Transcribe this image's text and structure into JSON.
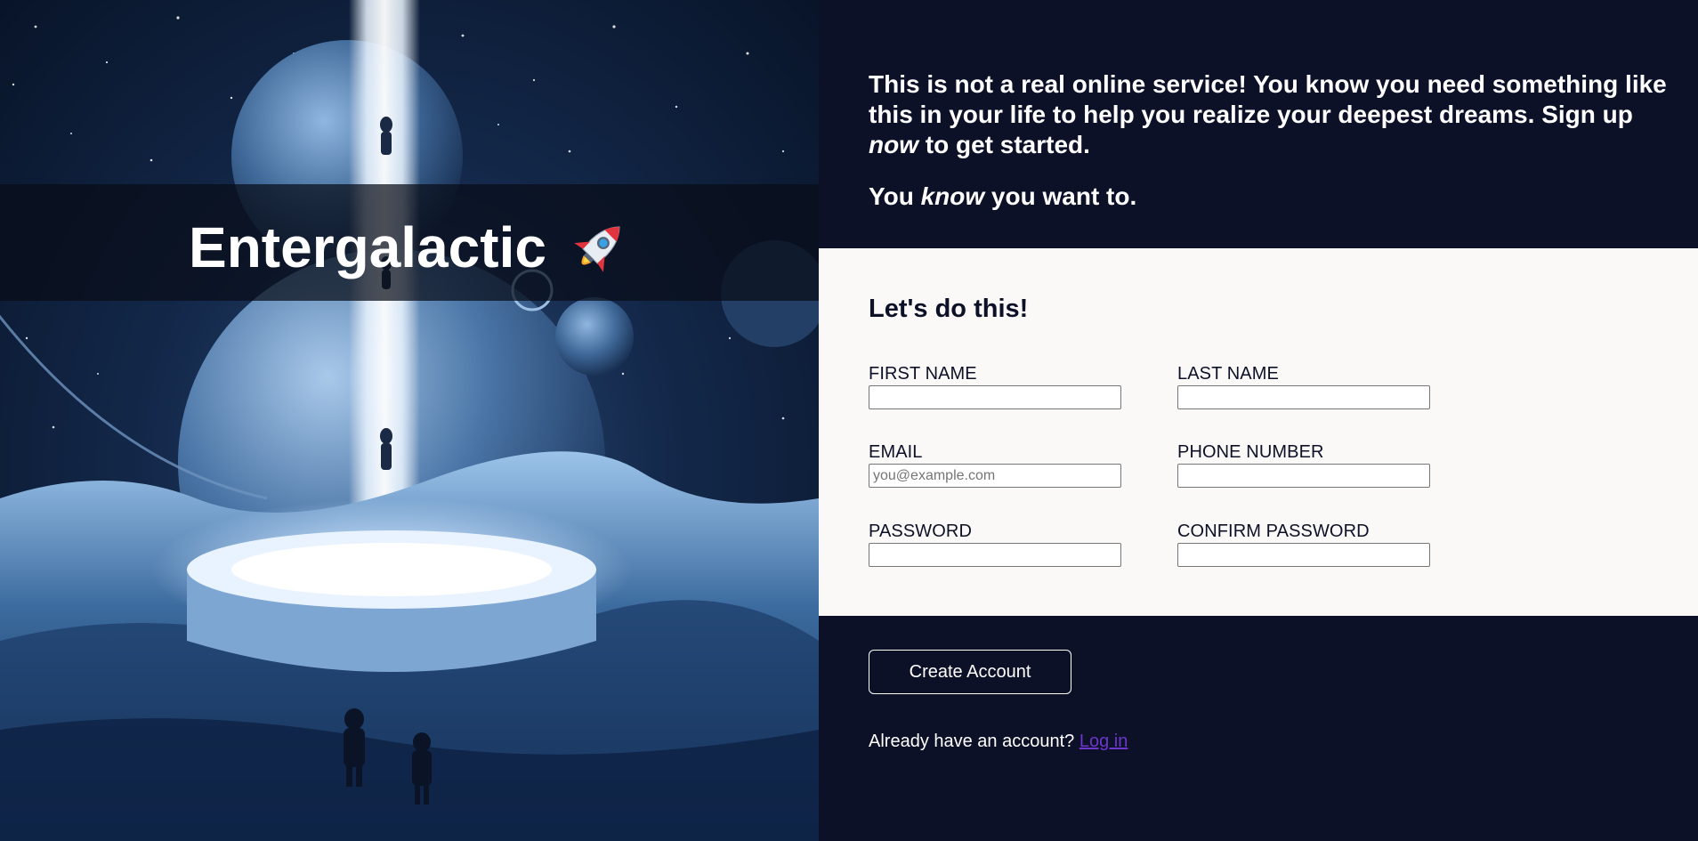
{
  "hero": {
    "brand_title": "Entergalactic",
    "brand_icon": "rocket-icon",
    "image_alt": "astronauts-on-alien-planet-illustration"
  },
  "intro": {
    "line1_a": "This is not a real online service! You know you need something like this in your life to help you realize your deepest dreams. Sign up ",
    "line1_em": "now",
    "line1_b": " to get started.",
    "line2_a": "You ",
    "line2_em": "know",
    "line2_b": " you want to."
  },
  "form": {
    "heading": "Let's do this!",
    "fields": {
      "first_name": {
        "label": "FIRST NAME",
        "value": "",
        "placeholder": ""
      },
      "last_name": {
        "label": "LAST NAME",
        "value": "",
        "placeholder": ""
      },
      "email": {
        "label": "EMAIL",
        "value": "",
        "placeholder": "you@example.com"
      },
      "phone": {
        "label": "PHONE NUMBER",
        "value": "",
        "placeholder": ""
      },
      "password": {
        "label": "PASSWORD",
        "value": "",
        "placeholder": ""
      },
      "confirm_password": {
        "label": "CONFIRM PASSWORD",
        "value": "",
        "placeholder": ""
      }
    }
  },
  "actions": {
    "create_account_label": "Create Account",
    "login_prompt": "Already have an account? ",
    "login_link_label": "Log in"
  },
  "colors": {
    "panel_bg": "#0d1128",
    "form_bg": "#fbf9f7",
    "link": "#6b36c9"
  }
}
